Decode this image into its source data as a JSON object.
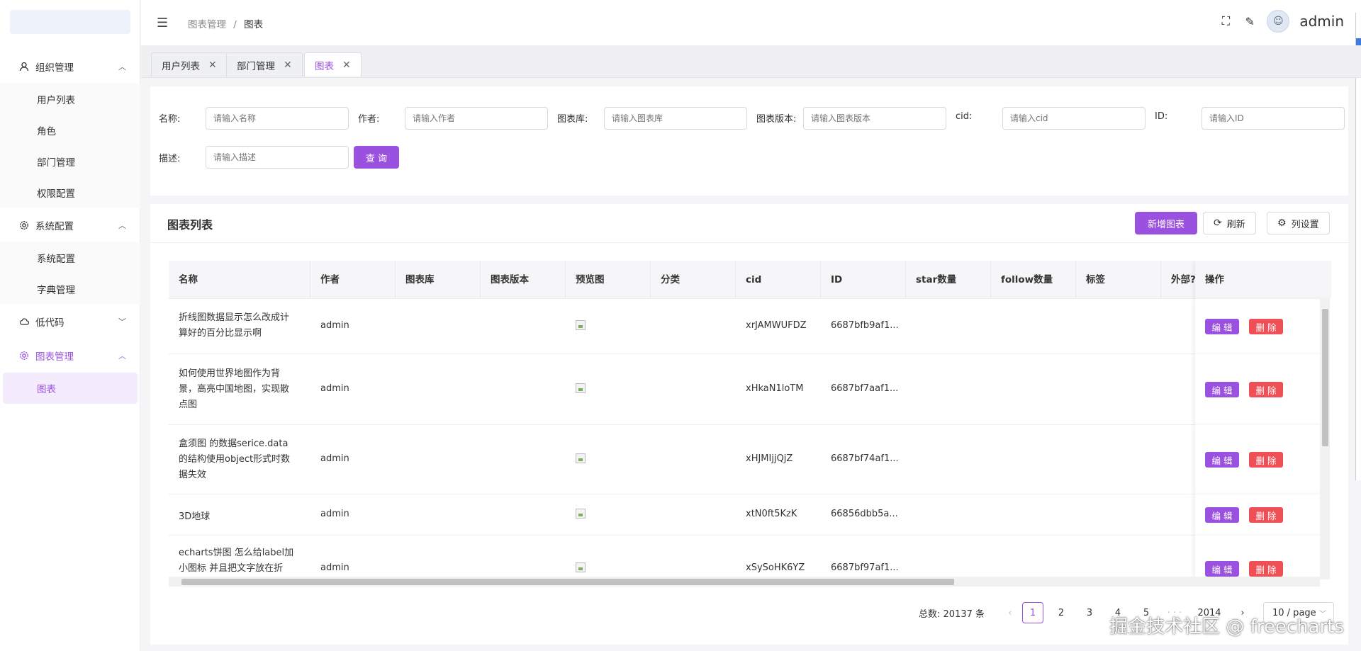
{
  "sidebar": {
    "groups": [
      {
        "label": "组织管理",
        "icon": "user-icon",
        "expanded": true,
        "items": [
          "用户列表",
          "角色",
          "部门管理",
          "权限配置"
        ]
      },
      {
        "label": "系统配置",
        "icon": "gear-icon",
        "expanded": true,
        "items": [
          "系统配置",
          "字典管理"
        ]
      },
      {
        "label": "低代码",
        "icon": "cloud-icon",
        "expanded": false,
        "items": []
      },
      {
        "label": "图表管理",
        "icon": "gear-icon",
        "expanded": true,
        "items": [
          "图表"
        ]
      }
    ]
  },
  "header": {
    "breadcrumb": [
      "图表管理",
      "图表"
    ],
    "separator": "/",
    "username": "admin"
  },
  "tabs": [
    {
      "label": "用户列表",
      "active": false
    },
    {
      "label": "部门管理",
      "active": false
    },
    {
      "label": "图表",
      "active": true
    }
  ],
  "filter": {
    "fields": [
      {
        "label": "名称:",
        "placeholder": "请输入名称"
      },
      {
        "label": "作者:",
        "placeholder": "请输入作者"
      },
      {
        "label": "图表库:",
        "placeholder": "请输入图表库"
      },
      {
        "label": "图表版本:",
        "placeholder": "请输入图表版本"
      },
      {
        "label": "cid:",
        "placeholder": "请输入cid"
      },
      {
        "label": "ID:",
        "placeholder": "请输入ID"
      },
      {
        "label": "描述:",
        "placeholder": "请输入描述"
      }
    ],
    "query_label": "查 询"
  },
  "list": {
    "title": "图表列表",
    "add_label": "新增图表",
    "refresh_label": "刷新",
    "columns_label": "列设置",
    "columns": [
      "名称",
      "作者",
      "图表库",
      "图表版本",
      "预览图",
      "分类",
      "cid",
      "ID",
      "star数量",
      "follow数量",
      "标签",
      "外部?",
      "操作"
    ],
    "rows": [
      {
        "name": "折线图数据显示怎么改成计算好的百分比显示啊",
        "author": "admin",
        "cid": "xrJAMWUFDZ",
        "id": "6687bfb9af1..."
      },
      {
        "name": "如何使用世界地图作为背景，高亮中国地图，实现散点图",
        "author": "admin",
        "cid": "xHkaN1loTM",
        "id": "6687bf7aaf1..."
      },
      {
        "name": "盒须图 的数据serice.data的结构使用object形式时数据失效",
        "author": "admin",
        "cid": "xHJMIjjQjZ",
        "id": "6687bf74af1..."
      },
      {
        "name": "3D地球",
        "author": "admin",
        "cid": "xtN0ft5KzK",
        "id": "66856dbb5a..."
      },
      {
        "name": "echarts饼图 怎么给label加小图标 并且把文字放在折",
        "author": "admin",
        "cid": "xSySoHK6YZ",
        "id": "6687bf97af1..."
      }
    ],
    "edit_label": "编 辑",
    "delete_label": "删 除"
  },
  "pagination": {
    "total_label": "总数: 20137 条",
    "prev": "‹",
    "next": "›",
    "pages": [
      "1",
      "2",
      "3",
      "4",
      "5",
      "· · ·",
      "2014"
    ],
    "current": "1",
    "page_size": "10 / page"
  },
  "watermark": "掘金技术社区 @ freecharts",
  "colors": {
    "accent": "#9b51e0",
    "danger": "#ee5056"
  }
}
